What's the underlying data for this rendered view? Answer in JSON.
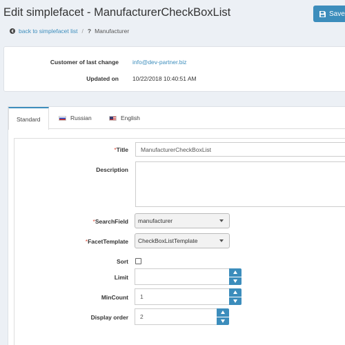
{
  "header": {
    "title": "Edit simplefacet - ManufacturerCheckBoxList",
    "save_label": "Save"
  },
  "breadcrumb": {
    "back_label": "back to simplefacet list",
    "current_label": "Manufacturer"
  },
  "info": {
    "customer_label": "Customer of last change",
    "customer_value": "info@dev-partner.biz",
    "updated_label": "Updated on",
    "updated_value": "10/22/2018 10:40:51 AM"
  },
  "tabs": [
    {
      "label": "Standard",
      "active": true
    },
    {
      "label": "Russian",
      "flag": "flag-ru-icon"
    },
    {
      "label": "English",
      "flag": "flag-us-icon"
    }
  ],
  "form": {
    "title": {
      "label": "Title",
      "value": "ManufacturerCheckBoxList",
      "required": true
    },
    "description": {
      "label": "Description",
      "value": ""
    },
    "search_field": {
      "label": "SearchField",
      "value": "manufacturer",
      "required": true
    },
    "facet_template": {
      "label": "FacetTemplate",
      "value": "CheckBoxListTemplate",
      "required": true
    },
    "sort": {
      "label": "Sort",
      "checked": false
    },
    "limit": {
      "label": "Limit",
      "value": ""
    },
    "min_count": {
      "label": "MinCount",
      "value": "1"
    },
    "display_order": {
      "label": "Display order",
      "value": "2"
    }
  },
  "colors": {
    "accent": "#3c8dbc",
    "required": "#dd4b39",
    "page_bg": "#ecf0f5"
  }
}
